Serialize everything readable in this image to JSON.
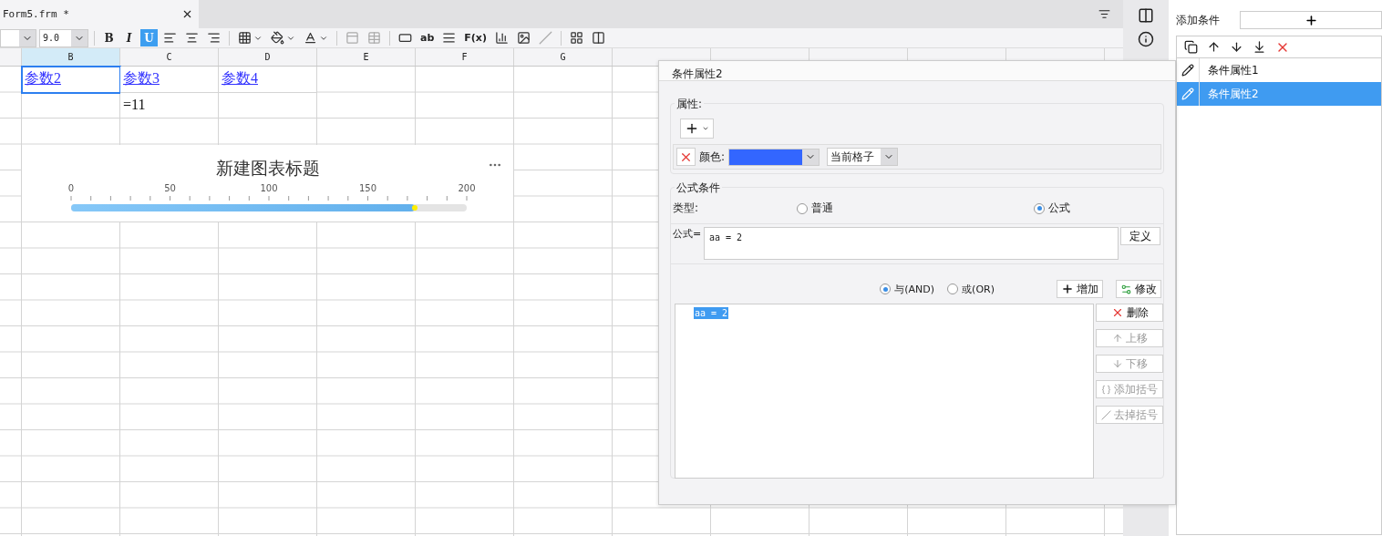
{
  "tab": {
    "title": "Form5.frm *"
  },
  "toolbar": {
    "font_size": "9.0",
    "tools": [
      {
        "kind": "bold",
        "label": "B",
        "selected": false
      },
      {
        "kind": "italic",
        "label": "I",
        "selected": false
      },
      {
        "kind": "underline",
        "label": "U",
        "selected": true
      },
      {
        "kind": "align-left"
      },
      {
        "kind": "align-center"
      },
      {
        "kind": "align-right"
      },
      {
        "kind": "sep"
      },
      {
        "kind": "border"
      },
      {
        "kind": "fill"
      },
      {
        "kind": "font-color"
      },
      {
        "kind": "sep"
      },
      {
        "kind": "merge"
      },
      {
        "kind": "table"
      },
      {
        "kind": "sep"
      },
      {
        "kind": "field"
      },
      {
        "kind": "text",
        "label": "ab"
      },
      {
        "kind": "lines"
      },
      {
        "kind": "text",
        "label": "F(x)"
      },
      {
        "kind": "bars"
      },
      {
        "kind": "image"
      },
      {
        "kind": "slash"
      },
      {
        "kind": "sep"
      },
      {
        "kind": "layout"
      },
      {
        "kind": "list"
      }
    ]
  },
  "columns": [
    {
      "label": "B",
      "selected": true
    },
    {
      "label": "C",
      "selected": false
    },
    {
      "label": "D",
      "selected": false
    },
    {
      "label": "E",
      "selected": false
    },
    {
      "label": "F",
      "selected": false
    },
    {
      "label": "G",
      "selected": false
    }
  ],
  "rows": [
    {
      "cells": [
        {
          "text": "参数2",
          "kind": "link",
          "selected": true
        },
        {
          "text": "参数3",
          "kind": "link",
          "selected": false
        },
        {
          "text": "参数4",
          "kind": "link",
          "selected": false
        }
      ]
    },
    {
      "cells": [
        {
          "kind": "empty"
        },
        {
          "text": "=11",
          "kind": "plain",
          "selected": false
        }
      ]
    }
  ],
  "chart": {
    "title": "新建图表标题",
    "ticks": [
      "0",
      "50",
      "100",
      "150",
      "200"
    ],
    "level": 0.87
  },
  "dialog": {
    "title": "条件属性2",
    "properties": {
      "legend": "属性:",
      "rows": [
        {
          "label": "颜色:",
          "color": "#3366ff",
          "scope": "当前格子"
        }
      ]
    },
    "formula": {
      "legend": "公式条件",
      "type_label": "类型:",
      "types": [
        {
          "label": "普通",
          "selected": false
        },
        {
          "label": "公式",
          "selected": true
        }
      ],
      "formula_label": "公式=",
      "formula_value": "aa = 2",
      "define_button": "定义",
      "logic": [
        {
          "label": "与(AND)",
          "selected": true
        },
        {
          "label": "或(OR)",
          "selected": false
        }
      ],
      "add_button": "增加",
      "modify_button": "修改",
      "conditions": [
        {
          "text": "aa = 2",
          "selected": true
        }
      ],
      "side_buttons": [
        {
          "kind": "delete",
          "label": "删除",
          "disabled": false
        },
        {
          "kind": "up",
          "label": "上移",
          "disabled": true
        },
        {
          "kind": "down",
          "label": "下移",
          "disabled": true
        },
        {
          "kind": "add-paren",
          "label": "添加括号",
          "disabled": true
        },
        {
          "kind": "remove-paren",
          "label": "去掉括号",
          "disabled": true
        }
      ]
    }
  },
  "panel": {
    "add_label": "添加条件",
    "items": [
      {
        "label": "条件属性1",
        "selected": false
      },
      {
        "label": "条件属性2",
        "selected": true
      }
    ]
  }
}
